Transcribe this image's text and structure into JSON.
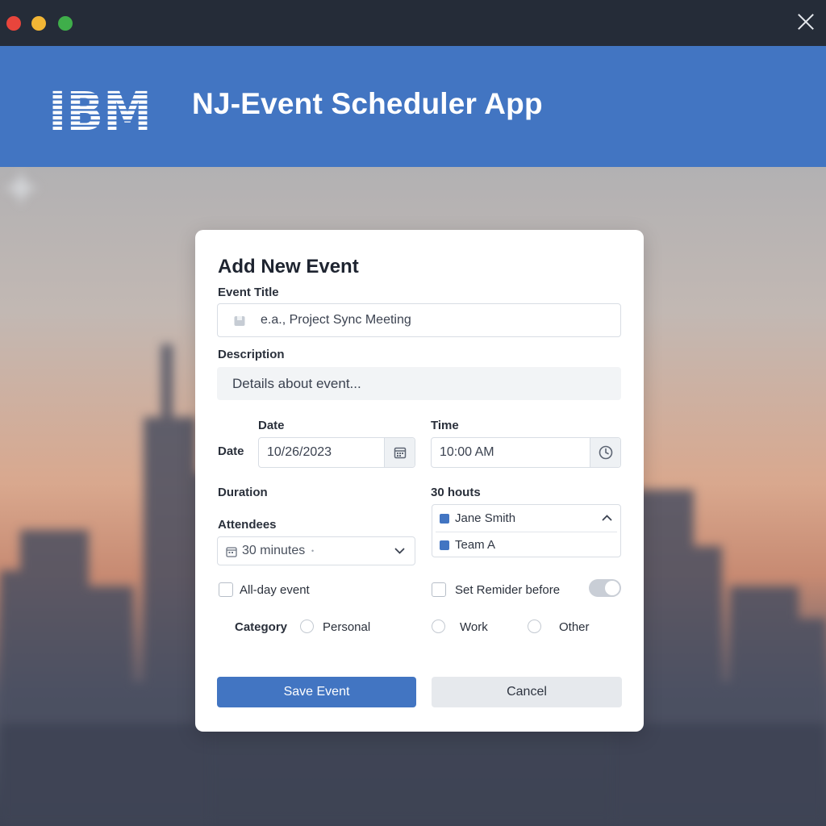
{
  "window": {
    "close_icon": "close-icon"
  },
  "header": {
    "logo_text": "IBM",
    "title": "NJ-Event Scheduler App"
  },
  "form": {
    "title": "Add New Event",
    "event_title": {
      "label": "Event Title",
      "placeholder": "e.a., Project Sync Meeting",
      "icon": "document-icon"
    },
    "description": {
      "label": "Description",
      "placeholder": "Details about event..."
    },
    "date": {
      "heading": "Date",
      "row_label": "Date",
      "value": "10/26/2023",
      "icon": "calendar-icon"
    },
    "time": {
      "heading": "Time",
      "value": "10:00 AM",
      "icon": "clock-icon"
    },
    "duration": {
      "label": "Duration",
      "value_label": "30 houts",
      "select_value": "30 minutes",
      "extra_mark": "•"
    },
    "attendees": {
      "label": "Attendees",
      "items": [
        "Jane Smith",
        "Team A"
      ],
      "accent": "#4275c2"
    },
    "all_day": {
      "label": "All-day event",
      "checked": false
    },
    "reminder": {
      "label": "Set Remider before",
      "checked": false,
      "toggle_on": false
    },
    "category": {
      "label": "Category",
      "options": [
        "Personal",
        "Work",
        "Other"
      ],
      "selected": null
    },
    "buttons": {
      "save": "Save Event",
      "cancel": "Cancel"
    }
  },
  "colors": {
    "brand_blue": "#4275c2",
    "titlebar": "#252c38"
  }
}
